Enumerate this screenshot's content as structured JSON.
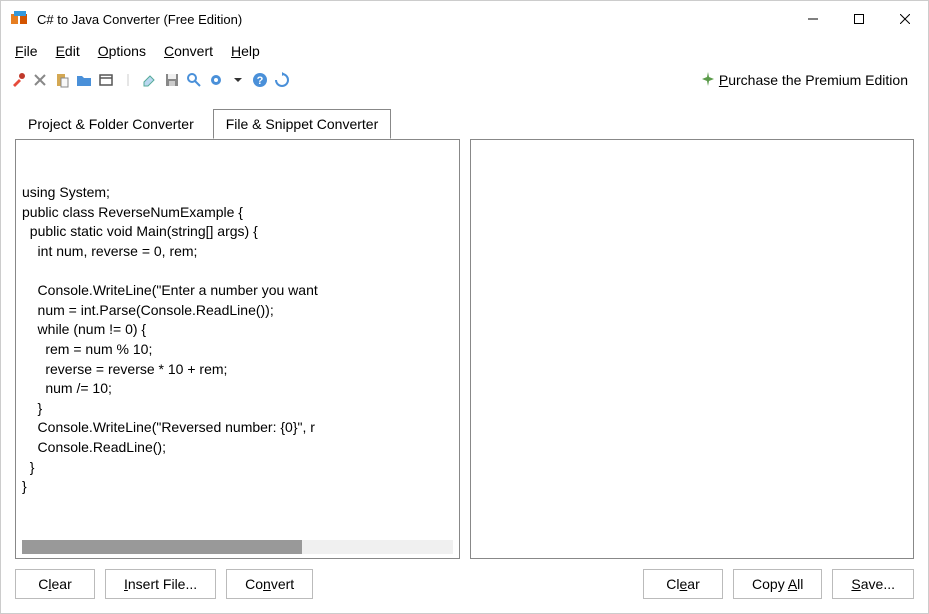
{
  "window": {
    "title": "C# to Java Converter (Free Edition)"
  },
  "menu": {
    "file": "File",
    "edit": "Edit",
    "options": "Options",
    "convert": "Convert",
    "help": "Help"
  },
  "toolbar": {
    "premium_text": "Purchase the Premium Edition"
  },
  "tabs": {
    "project": "Project & Folder Converter",
    "snippet": "File & Snippet Converter"
  },
  "code": {
    "left": "using System;\npublic class ReverseNumExample {\n  public static void Main(string[] args) {\n    int num, reverse = 0, rem;\n\n    Console.WriteLine(\"Enter a number you want\n    num = int.Parse(Console.ReadLine());\n    while (num != 0) {\n      rem = num % 10;\n      reverse = reverse * 10 + rem;\n      num /= 10;\n    }\n    Console.WriteLine(\"Reversed number: {0}\", r\n    Console.ReadLine();\n  }\n}",
    "right": ""
  },
  "buttons": {
    "clear_left": "Clear",
    "insert_file": "Insert File...",
    "convert": "Convert",
    "clear_right": "Clear",
    "copy_all": "Copy All",
    "save": "Save..."
  }
}
